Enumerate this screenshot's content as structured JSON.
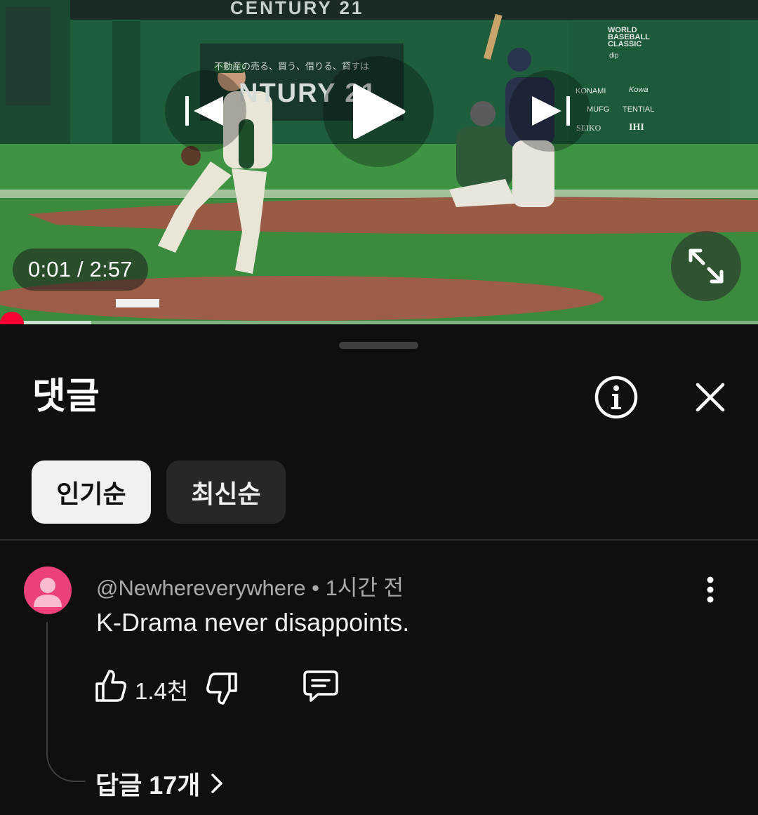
{
  "video": {
    "current_time": "0:01",
    "duration": "2:57",
    "time_display": "0:01 / 2:57",
    "progress_fraction": 0.006,
    "buffer_fraction": 0.12,
    "scene_signage": {
      "banner_top": "CENTURY 21",
      "board_jp": "不動産の売る、買う、借りる、貸すは",
      "board_brand": "NTURY 21",
      "wbc_logo": "WORLD BASEBALL CLASSIC",
      "wbc_sub": "dip",
      "sponsors": [
        "KONAMI",
        "Kowa",
        "MUFG",
        "TENTIAL",
        "SEIKO",
        "IHI"
      ]
    }
  },
  "comments_panel": {
    "title": "댓글",
    "sort_chips": [
      {
        "label": "인기순",
        "selected": true
      },
      {
        "label": "최신순",
        "selected": false
      }
    ]
  },
  "comment": {
    "author": "@Newhereverywhere",
    "separator": " • ",
    "time_ago": "1시간 전",
    "text": "K-Drama never disappoints.",
    "like_count": "1.4천",
    "replies_label": "답글 17개"
  },
  "icons": {
    "prev": "skip-previous-icon",
    "play": "play-icon",
    "next": "skip-next-icon",
    "fullscreen": "fullscreen-icon",
    "info": "info-icon",
    "close": "close-icon",
    "more": "more-vert-icon",
    "like": "thumb-up-icon",
    "dislike": "thumb-down-icon",
    "reply": "comment-icon",
    "chevron": "chevron-right-icon",
    "avatar": "person-icon"
  },
  "colors": {
    "accent_red": "#ff0033",
    "background": "#0f0f0f",
    "chip_selected_bg": "#f1f1f1",
    "chip_bg": "#272727",
    "avatar_bg": "#ec407a"
  }
}
